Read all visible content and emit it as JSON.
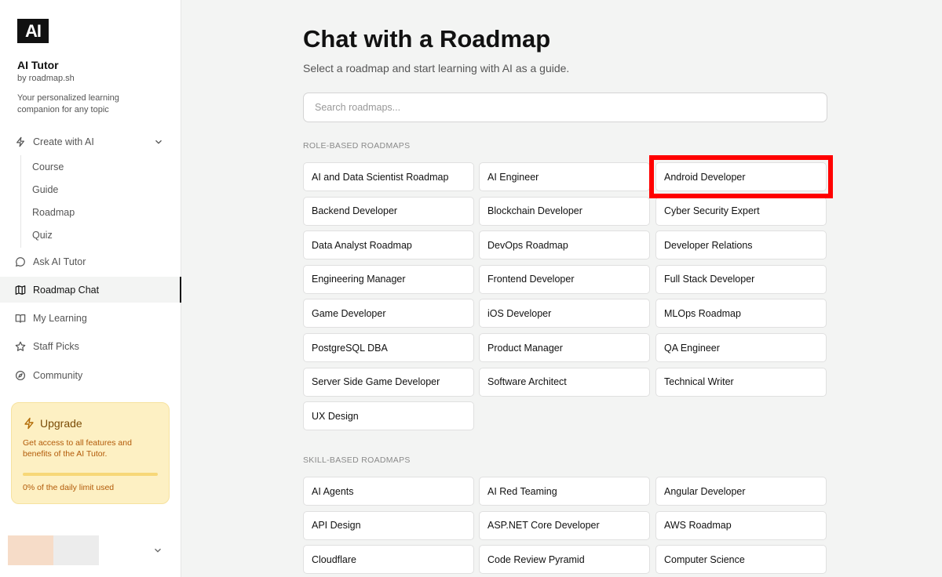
{
  "sidebar": {
    "logo_text": "AI",
    "app_title": "AI Tutor",
    "app_by": "by roadmap.sh",
    "app_desc": "Your personalized learning companion for any topic",
    "nav": {
      "create": "Create with AI",
      "course": "Course",
      "guide": "Guide",
      "roadmap": "Roadmap",
      "quiz": "Quiz",
      "ask": "Ask AI Tutor",
      "roadmap_chat": "Roadmap Chat",
      "my_learning": "My Learning",
      "staff_picks": "Staff Picks",
      "community": "Community"
    },
    "upgrade": {
      "title": "Upgrade",
      "desc": "Get access to all features and benefits of the AI Tutor.",
      "usage": "0% of the daily limit used",
      "usage_percent": 0
    }
  },
  "main": {
    "title": "Chat with a Roadmap",
    "subtitle": "Select a roadmap and start learning with AI as a guide.",
    "search_placeholder": "Search roadmaps...",
    "role_label": "ROLE-BASED ROADMAPS",
    "skill_label": "SKILL-BASED ROADMAPS",
    "role_roadmaps": [
      "AI and Data Scientist Roadmap",
      "AI Engineer",
      "Android Developer",
      "Backend Developer",
      "Blockchain Developer",
      "Cyber Security Expert",
      "Data Analyst Roadmap",
      "DevOps Roadmap",
      "Developer Relations",
      "Engineering Manager",
      "Frontend Developer",
      "Full Stack Developer",
      "Game Developer",
      "iOS Developer",
      "MLOps Roadmap",
      "PostgreSQL DBA",
      "Product Manager",
      "QA Engineer",
      "Server Side Game Developer",
      "Software Architect",
      "Technical Writer",
      "UX Design"
    ],
    "skill_roadmaps": [
      "AI Agents",
      "AI Red Teaming",
      "Angular Developer",
      "API Design",
      "ASP.NET Core Developer",
      "AWS Roadmap",
      "Cloudflare",
      "Code Review Pyramid",
      "Computer Science"
    ]
  }
}
